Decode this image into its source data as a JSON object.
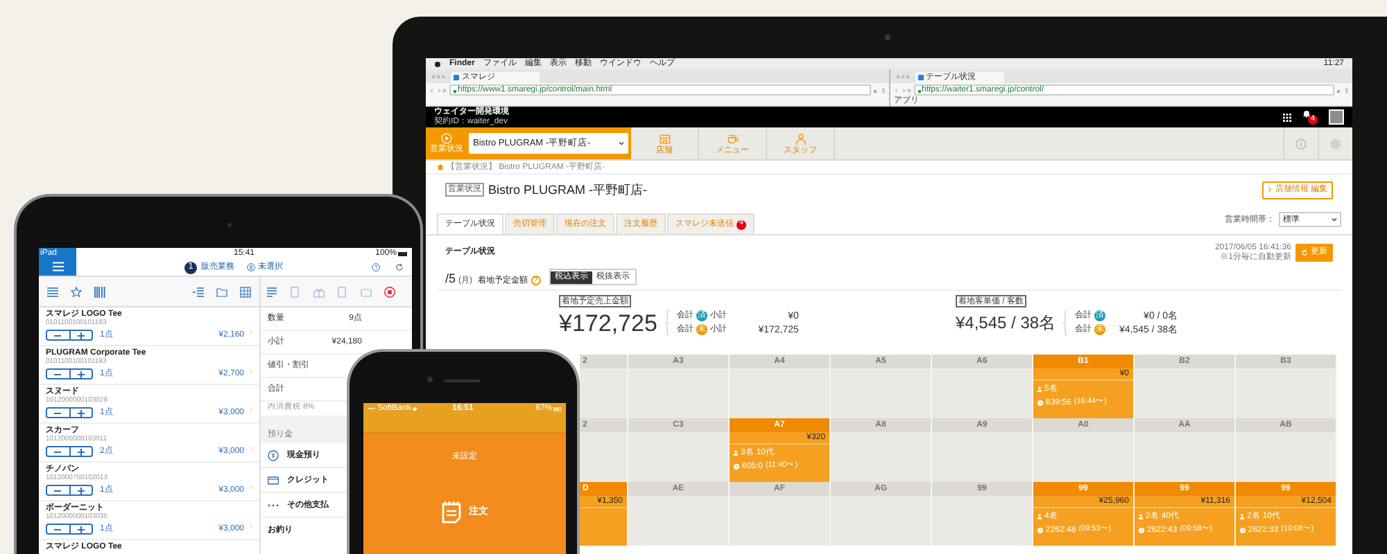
{
  "laptop": {
    "menu_bar": {
      "items": [
        "Finder",
        "ファイル",
        "編集",
        "表示",
        "移動",
        "ウインドウ",
        "ヘルプ"
      ],
      "clock": "11:27"
    },
    "browser_windows": [
      {
        "tab_title": "スマレジ",
        "url": "https://www1.smaregi.jp/control/main.html"
      },
      {
        "tab_title": "テーブル状況",
        "url": "https://waiter1.smaregi.jp/control/",
        "bookmark": "アプリ"
      }
    ],
    "header": {
      "title": "ウェイター開発環境",
      "account": "契約ID：waiter_dev",
      "notification_count": "4"
    },
    "nav": {
      "current": "営業状況",
      "store_select": "Bistro PLUGRAM -平野町店-",
      "items": [
        {
          "label": "店舗",
          "kind": "store"
        },
        {
          "label": "メニュー",
          "kind": "menu"
        },
        {
          "label": "スタッフ",
          "kind": "staff"
        }
      ]
    },
    "breadcrumb": "【営業状況】 Bistro PLUGRAM -平野町店-",
    "page_title": {
      "badge": "営業状況",
      "title": "Bistro PLUGRAM -平野町店-",
      "edit_button": "店舗情報 編集"
    },
    "tabs": [
      {
        "label": "テーブル状況",
        "selected": true
      },
      {
        "label": "売切管理",
        "selected": false
      },
      {
        "label": "現在の注文",
        "selected": false
      },
      {
        "label": "注文履歴",
        "selected": false
      },
      {
        "label": "スマレジ未送信",
        "selected": false,
        "badge": "4"
      }
    ],
    "time_slot": {
      "label": "営業時間帯：",
      "value": "標準"
    },
    "section_title": "テーブル状況",
    "update": {
      "timestamp": "2017/06/05 16:41:36",
      "note": "※1分毎に自動更新",
      "button": "更新"
    },
    "forecast": {
      "date": "/5",
      "weekday": "(月)",
      "label": "着地予定金額",
      "help": "?"
    },
    "tax_toggle": [
      {
        "label": "税込表示",
        "selected": true
      },
      {
        "label": "税抜表示",
        "selected": false
      }
    ],
    "stats": [
      {
        "label": "着地予定売上金額",
        "value": "¥172,725",
        "rows": [
          {
            "prefix": "会計",
            "status": "済",
            "color": "#1b9ab4",
            "suffix": "小計",
            "value": "¥0"
          },
          {
            "prefix": "会計",
            "status": "未",
            "color": "#f39800",
            "suffix": "小計",
            "value": "¥172,725"
          }
        ]
      },
      {
        "label": "着地客単価 / 客数",
        "value": "¥4,545 / 38名",
        "rows": [
          {
            "prefix": "会計",
            "status": "済",
            "color": "#1b9ab4",
            "value": "¥0 / 0名"
          },
          {
            "prefix": "会計",
            "status": "未",
            "color": "#f39800",
            "value": "¥4,545 / 38名"
          }
        ]
      }
    ],
    "tables": [
      [
        {
          "label": "2",
          "occupied": false
        },
        {
          "label": "A3",
          "occupied": false
        },
        {
          "label": "A4",
          "occupied": false
        },
        {
          "label": "A5",
          "occupied": false
        },
        {
          "label": "A6",
          "occupied": false
        },
        {
          "label": "B1",
          "occupied": true,
          "amount": "¥0",
          "guests": "5名",
          "time": "839:56",
          "since": "(16:44〜)"
        },
        {
          "label": "B2",
          "occupied": false
        },
        {
          "label": "B3",
          "occupied": false
        }
      ],
      [
        {
          "label": "2",
          "occupied": false
        },
        {
          "label": "C3",
          "occupied": false
        },
        {
          "label": "A7",
          "occupied": true,
          "amount": "¥320",
          "guests": "3名",
          "age": "10代",
          "time": "605:0",
          "since": "(11:40〜)"
        },
        {
          "label": "A8",
          "occupied": false
        },
        {
          "label": "A9",
          "occupied": false
        },
        {
          "label": "A0",
          "occupied": false
        },
        {
          "label": "AA",
          "occupied": false
        },
        {
          "label": "AB",
          "occupied": false
        }
      ],
      [
        {
          "label": "D",
          "occupied": true,
          "amount": "¥1,350"
        },
        {
          "label": "AE",
          "occupied": false
        },
        {
          "label": "AF",
          "occupied": false
        },
        {
          "label": "AG",
          "occupied": false
        },
        {
          "label": "99",
          "occupied": false
        },
        {
          "label": "99",
          "occupied": true,
          "amount": "¥25,960",
          "guests": "4名",
          "time": "2262:48",
          "since": "(09:53〜)"
        },
        {
          "label": "99",
          "occupied": true,
          "amount": "¥11,316",
          "guests": "2名",
          "age": "40代",
          "time": "2622:43",
          "since": "(09:58〜)"
        },
        {
          "label": "99",
          "occupied": true,
          "amount": "¥12,504",
          "guests": "2名",
          "age": "10代",
          "time": "2622:33",
          "since": "(10:08〜)"
        }
      ]
    ]
  },
  "tablet": {
    "status": {
      "carrier": "iPad",
      "time": "15:41",
      "battery": "100%"
    },
    "header": {
      "badge": "1",
      "title": "販売業務",
      "staff": "未選択"
    },
    "items": [
      {
        "name": "スマレジ LOGO Tee",
        "code": "0101100100101183",
        "qty": "1点",
        "price": "¥2,160"
      },
      {
        "name": "PLUGRAM Corporate Tee",
        "code": "0101100100101183",
        "qty": "1点",
        "price": "¥2,700"
      },
      {
        "name": "スヌード",
        "code": "1012000000103028",
        "qty": "1点",
        "price": "¥3,000"
      },
      {
        "name": "スカーフ",
        "code": "1012000000103011",
        "qty": "2点",
        "price": "¥3,000"
      },
      {
        "name": "チノパン",
        "code": "1012000750102013",
        "qty": "1点",
        "price": "¥3,000"
      },
      {
        "name": "ボーダーニット",
        "code": "1012000000103035",
        "qty": "1点",
        "price": "¥3,000"
      },
      {
        "name": "スマレジ LOGO Tee"
      }
    ],
    "summary": [
      {
        "label": "数量",
        "value": "9点"
      },
      {
        "label": "小計",
        "value": "¥24,180"
      },
      {
        "label": "値引・割引"
      },
      {
        "label": "合計"
      }
    ],
    "tax_note": "内消費税 8%",
    "deposit_header": "預り金",
    "payments": [
      {
        "label": "現金預り",
        "kind": "cash"
      },
      {
        "label": "クレジット",
        "kind": "card"
      },
      {
        "label": "その他支払",
        "kind": "other"
      }
    ],
    "change_label": "お釣り"
  },
  "phone": {
    "status": {
      "carrier": "SoftBank",
      "time": "16:51",
      "battery": "87%"
    },
    "title": "未設定",
    "order_button": "注文"
  }
}
